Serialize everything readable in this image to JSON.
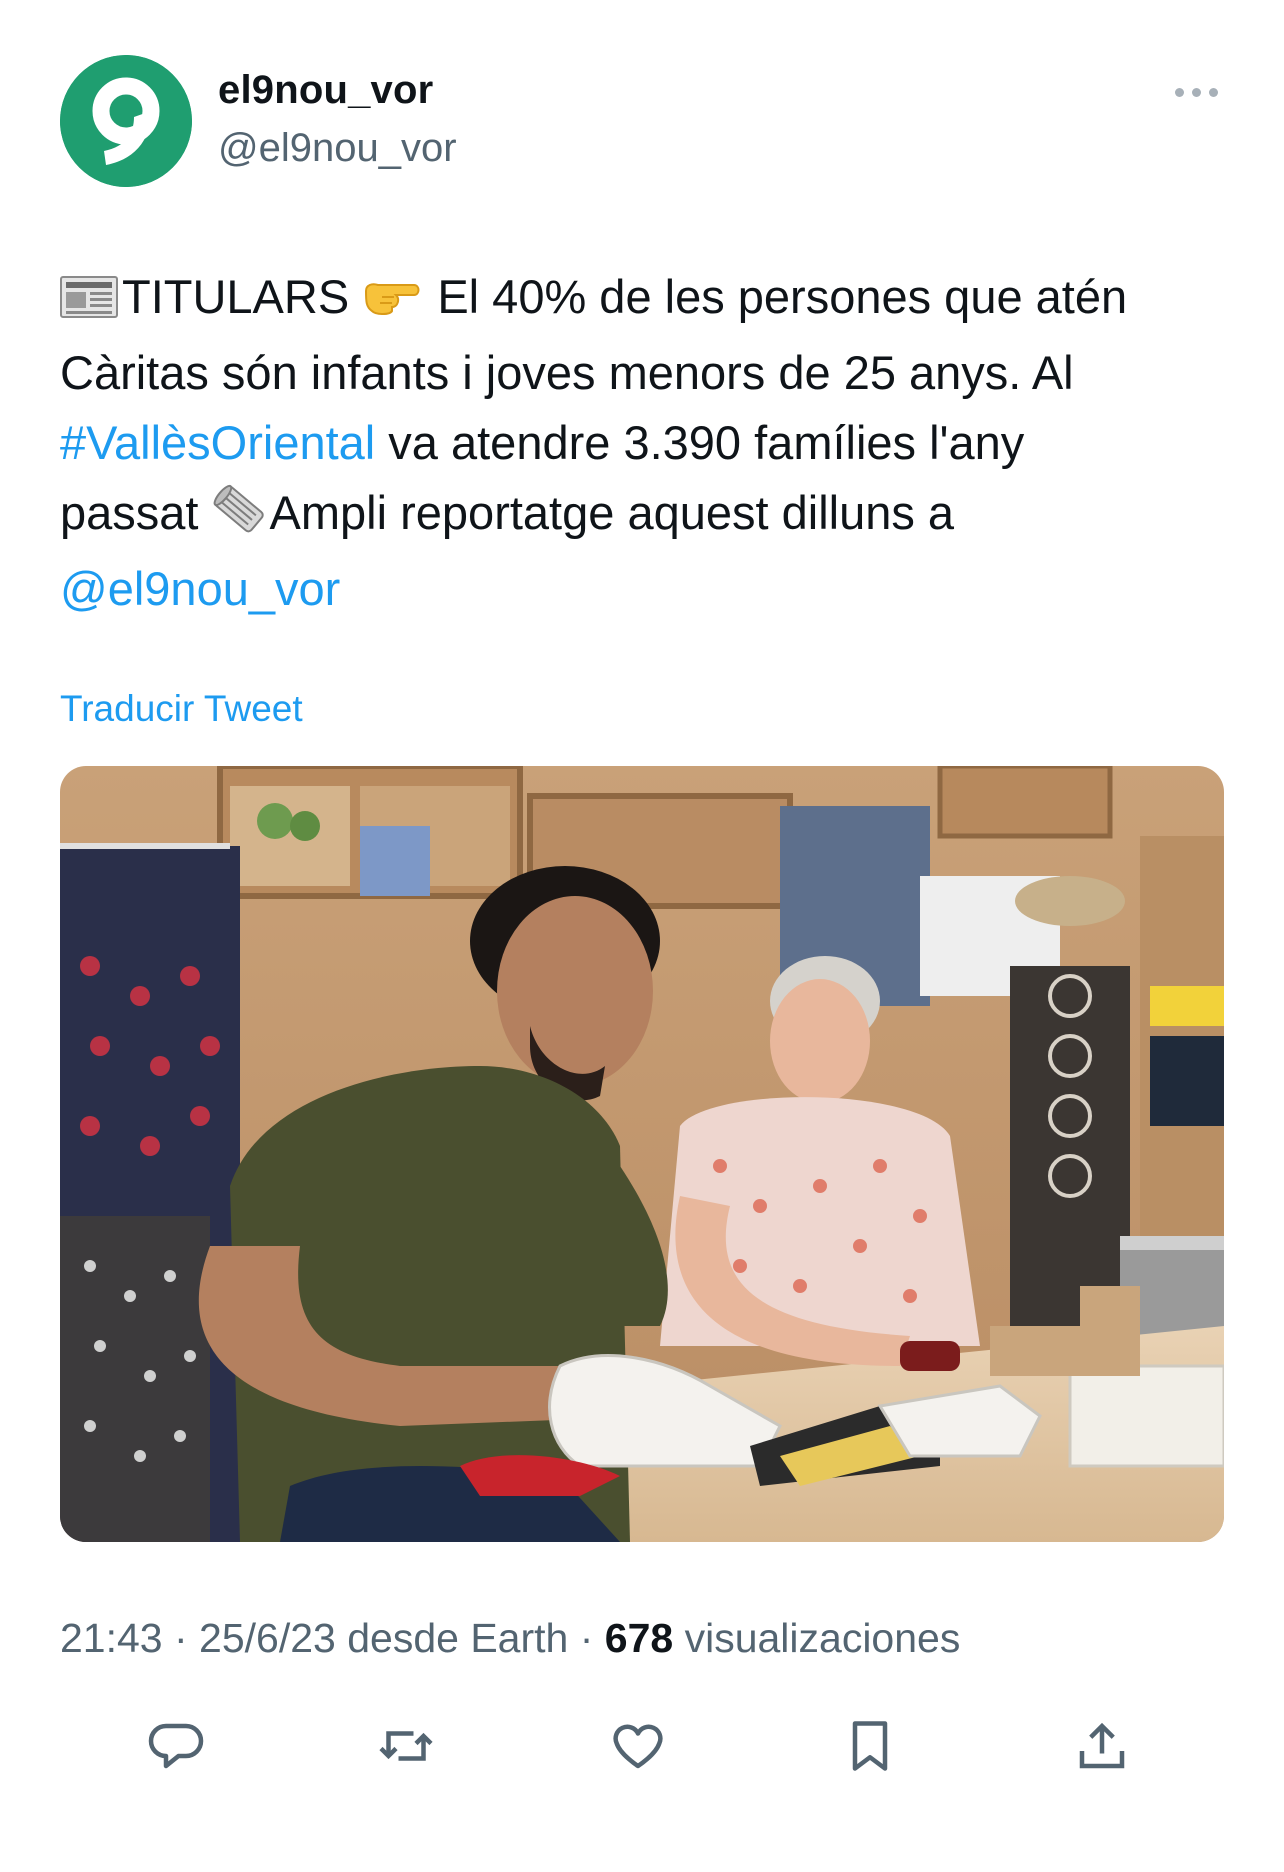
{
  "author": {
    "display_name": "el9nou_vor",
    "handle": "@el9nou_vor",
    "avatar_glyph": "9",
    "avatar_color": "#1f9e70"
  },
  "tweet": {
    "line1_text": "TITULARS",
    "line1_rest": "El 40% de les persones que atén",
    "line2": "Càritas són infants i joves menors de 25 anys. Al",
    "hashtag": "#VallèsOriental",
    "line3_rest": " va atendre 3.390 famílies l'any",
    "line4_start": "passat ",
    "line4_rest": "Ampli reportatge aquest dilluns a",
    "mention": "@el9nou_vor",
    "emojis": [
      "newspaper-emoji",
      "pointing-right-emoji",
      "rolled-newspaper-emoji"
    ]
  },
  "translate_label": "Traducir Tweet",
  "meta": {
    "time": "21:43",
    "separator": " · ",
    "date": "25/6/23",
    "source": " desde Earth",
    "views_count": "678",
    "views_label": " visualizaciones"
  },
  "actions": [
    "reply-icon",
    "retweet-icon",
    "like-icon",
    "bookmark-icon",
    "share-icon"
  ],
  "colors": {
    "link": "#1d9bf0",
    "secondary_text": "#536471",
    "primary_text": "#0f1419",
    "brand_green": "#1f9e70"
  }
}
